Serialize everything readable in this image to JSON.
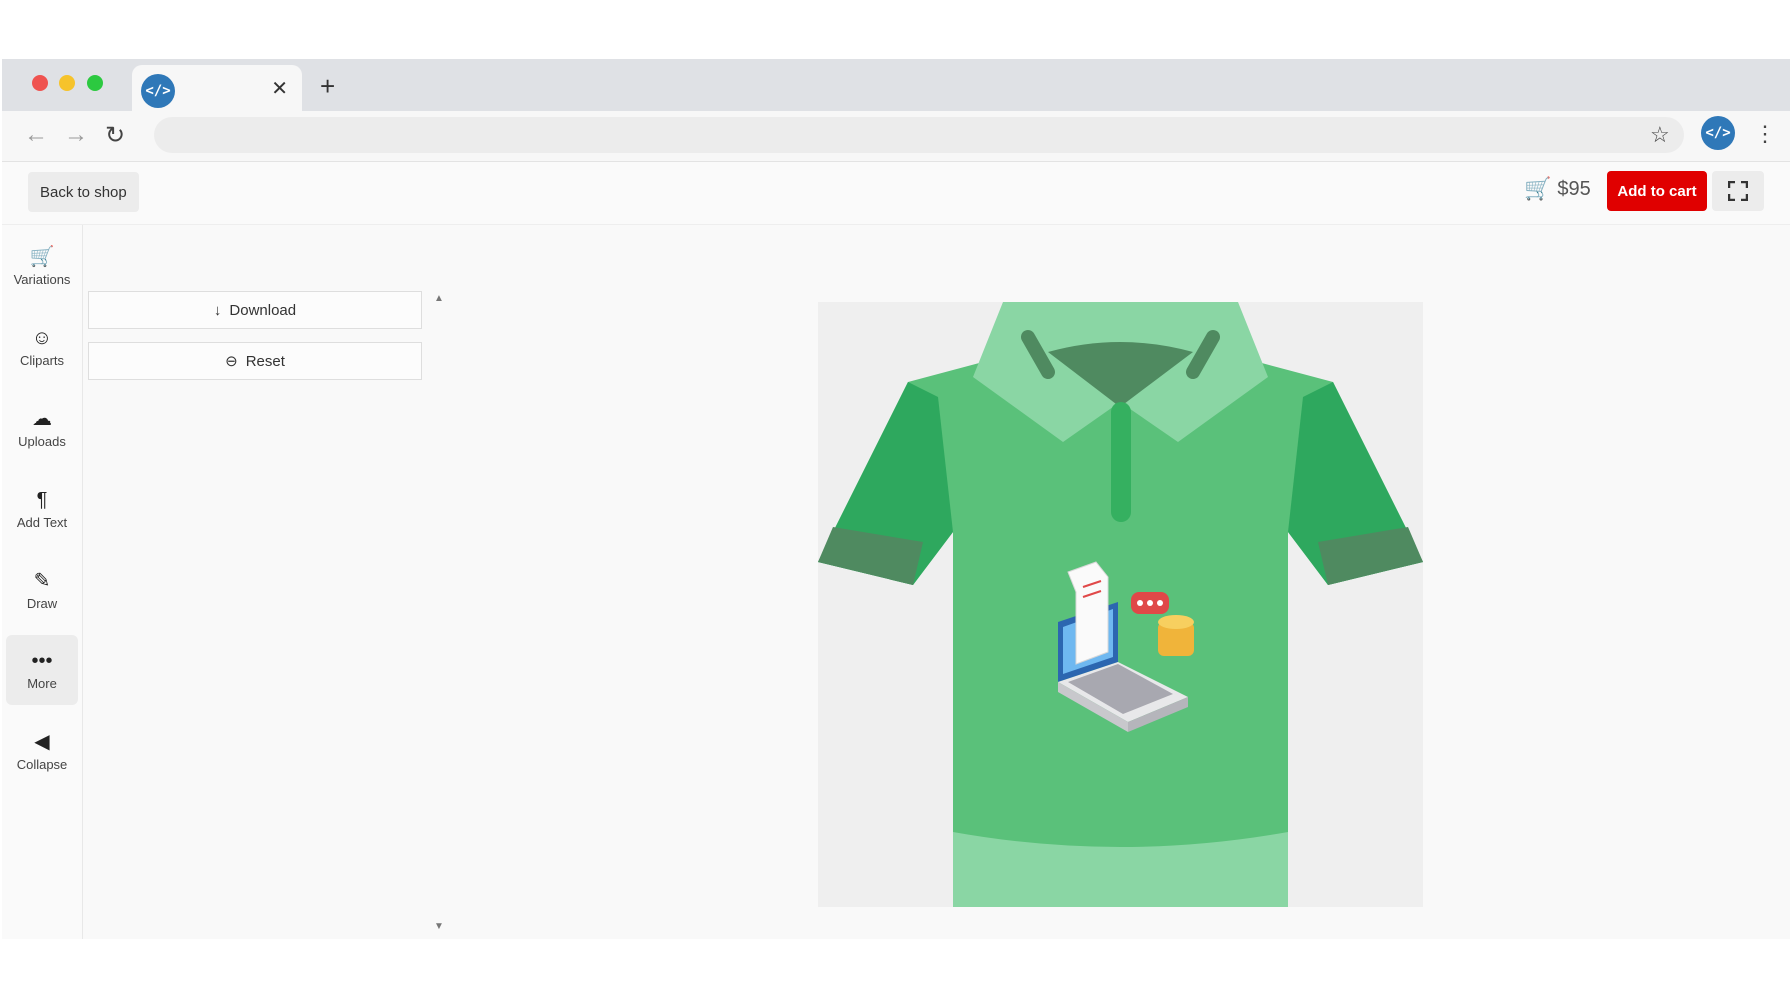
{
  "browser": {
    "tab_favicon": "</>",
    "tab_close": "✕",
    "new_tab": "+",
    "back_icon": "←",
    "forward_icon": "→",
    "reload_icon": "↻",
    "star_icon": "☆",
    "profile_badge": "</>",
    "menu_icon": "⋮"
  },
  "header": {
    "back_label": "Back to shop",
    "price": "$95",
    "add_to_cart": "Add to cart"
  },
  "sidebar": {
    "items": [
      {
        "label": "Variations",
        "icon": "🛒"
      },
      {
        "label": "Cliparts",
        "icon": "☺"
      },
      {
        "label": "Uploads",
        "icon": "☁"
      },
      {
        "label": "Add Text",
        "icon": "¶"
      },
      {
        "label": "Draw",
        "icon": "✎"
      },
      {
        "label": "More",
        "icon": "•••"
      },
      {
        "label": "Collapse",
        "icon": "◀"
      }
    ]
  },
  "panel": {
    "download_label": "Download",
    "download_icon": "↓",
    "reset_label": "Reset",
    "reset_icon": "⊖"
  },
  "colors": {
    "accent_red": "#e00000",
    "shirt_green": "#5ac17a",
    "shirt_dark": "#2ea85e",
    "collar_light": "#8ad6a4"
  }
}
